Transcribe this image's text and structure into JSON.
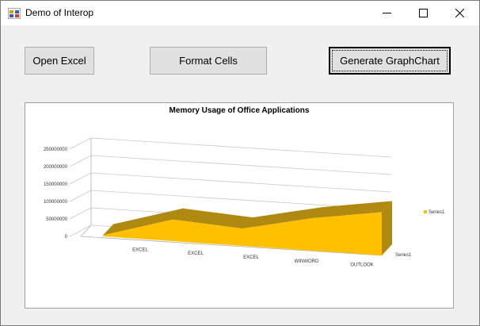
{
  "window": {
    "title": "Demo of Interop"
  },
  "buttons": {
    "open_excel": "Open Excel",
    "format_cells": "Format Cells",
    "generate_chart": "Generate GraphChart"
  },
  "chart_data": {
    "type": "area",
    "title": "Memory Usage of Office Applications",
    "categories": [
      "EXCEL",
      "EXCEL",
      "EXCEL",
      "WINWORD",
      "OUTLOOK"
    ],
    "series": [
      {
        "name": "Series1",
        "values": [
          5000000,
          100000000,
          80000000,
          150000000,
          200000000
        ]
      }
    ],
    "y_ticks": [
      "0",
      "50000000",
      "100000000",
      "150000000",
      "200000000",
      "250000000"
    ],
    "ylim": [
      0,
      250000000
    ],
    "depth_axis_label": "Series1",
    "legend": "right",
    "grid": true,
    "colors": {
      "area": "#ffc000",
      "area_side": "#b08a10"
    }
  }
}
